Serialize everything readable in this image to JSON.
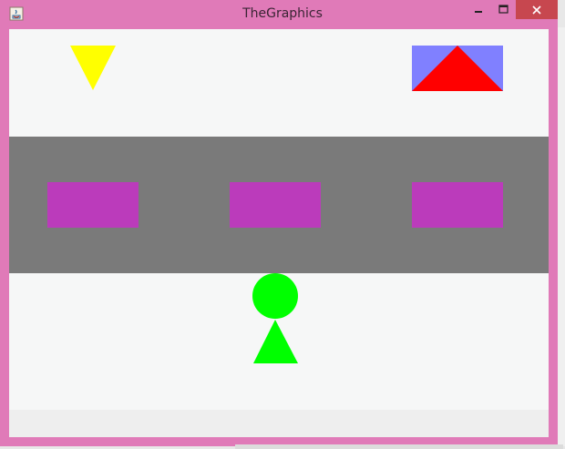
{
  "window": {
    "title": "TheGraphics",
    "controls": {
      "minimize_icon": "minimize-icon",
      "maximize_icon": "maximize-icon",
      "close_icon": "close-icon"
    },
    "app_icon": "java-app-icon"
  },
  "colors": {
    "frame": "#e07ab8",
    "close_button": "#c7474f",
    "canvas_background": "#f6f7f7",
    "road": "#7a7a7a",
    "lane_marks": "#bb3bbb",
    "yellow_triangle": "#ffff00",
    "house_background": "#8080ff",
    "roof": "#ff0000",
    "figure": "#00ff00"
  },
  "scene": {
    "shapes": [
      "yellow-triangle",
      "blue-rectangle",
      "red-roof-triangle",
      "gray-road",
      "purple-lane-mark-left",
      "purple-lane-mark-center",
      "purple-lane-mark-right",
      "green-circle-head",
      "green-triangle-body"
    ]
  }
}
